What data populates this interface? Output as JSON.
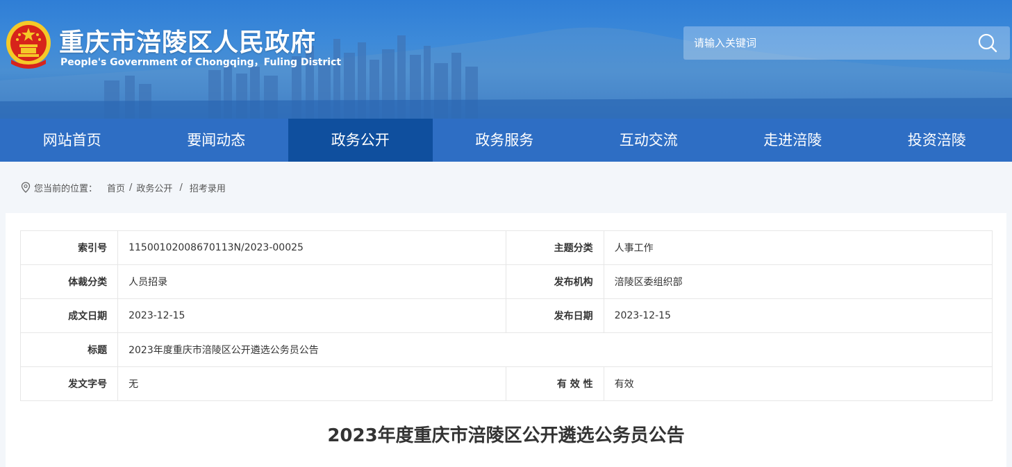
{
  "header": {
    "title": "重庆市涪陵区人民政府",
    "subtitle": "People's Government of Chongqing，Fuling District",
    "search_placeholder": "请输入关键词",
    "colors": {
      "brand_blue": "#2e6ec4",
      "nav_active": "#0f4f9e",
      "emblem_red": "#d7241b",
      "emblem_gold": "#f5c928"
    }
  },
  "nav": {
    "items": [
      {
        "label": "网站首页"
      },
      {
        "label": "要闻动态"
      },
      {
        "label": "政务公开"
      },
      {
        "label": "政务服务"
      },
      {
        "label": "互动交流"
      },
      {
        "label": "走进涪陵"
      },
      {
        "label": "投资涪陵"
      }
    ],
    "active_index": 2
  },
  "breadcrumb": {
    "prefix": "您当前的位置：",
    "items": [
      "首页",
      "政务公开",
      "招考录用"
    ]
  },
  "meta": {
    "rows": [
      {
        "k1": "索引号",
        "v1": "11500102008670113N/2023-00025",
        "k2": "主题分类",
        "v2": "人事工作"
      },
      {
        "k1": "体裁分类",
        "v1": "人员招录",
        "k2": "发布机构",
        "v2": "涪陵区委组织部"
      },
      {
        "k1": "成文日期",
        "v1": "2023-12-15",
        "k2": "发布日期",
        "v2": "2023-12-15"
      },
      {
        "k1": "标题",
        "v1": "2023年度重庆市涪陵区公开遴选公务员公告"
      },
      {
        "k1": "发文字号",
        "v1": "无",
        "k2": "有 效 性",
        "v2": "有效"
      }
    ]
  },
  "article": {
    "title": "2023年度重庆市涪陵区公开遴选公务员公告"
  }
}
